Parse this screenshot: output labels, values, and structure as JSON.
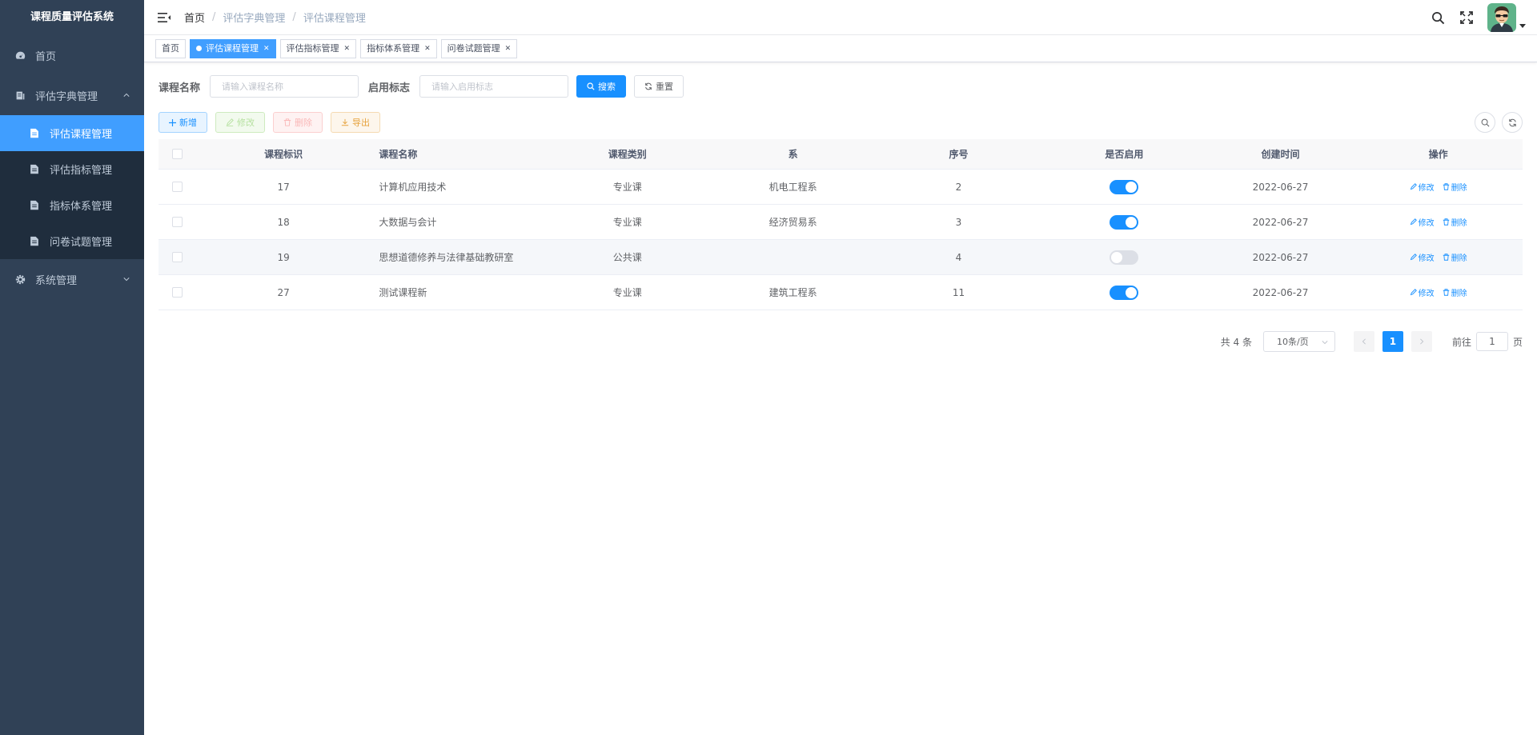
{
  "app": {
    "title": "课程质量评估系统"
  },
  "sidebar": {
    "items": [
      {
        "label": "首页",
        "icon": "dashboard-icon"
      },
      {
        "label": "评估字典管理",
        "icon": "dictionary-icon",
        "expanded": true,
        "children": [
          {
            "label": "评估课程管理",
            "active": true
          },
          {
            "label": "评估指标管理"
          },
          {
            "label": "指标体系管理"
          },
          {
            "label": "问卷试题管理"
          }
        ]
      },
      {
        "label": "系统管理",
        "icon": "gear-icon",
        "expanded": false
      }
    ]
  },
  "breadcrumb": [
    "首页",
    "评估字典管理",
    "评估课程管理"
  ],
  "tags": [
    {
      "label": "首页",
      "closable": false,
      "active": false
    },
    {
      "label": "评估课程管理",
      "closable": true,
      "active": true
    },
    {
      "label": "评估指标管理",
      "closable": true,
      "active": false
    },
    {
      "label": "指标体系管理",
      "closable": true,
      "active": false
    },
    {
      "label": "问卷试题管理",
      "closable": true,
      "active": false
    }
  ],
  "search": {
    "course_name_label": "课程名称",
    "course_name_placeholder": "请输入课程名称",
    "enabled_label": "启用标志",
    "enabled_placeholder": "请输入启用标志",
    "search_btn": "搜索",
    "reset_btn": "重置"
  },
  "toolbar": {
    "add": "新增",
    "edit": "修改",
    "delete": "删除",
    "export": "导出"
  },
  "table": {
    "headers": [
      "课程标识",
      "课程名称",
      "课程类别",
      "系",
      "序号",
      "是否启用",
      "创建时间",
      "操作"
    ],
    "rows": [
      {
        "id": "17",
        "name": "计算机应用技术",
        "category": "专业课",
        "dept": "机电工程系",
        "seq": "2",
        "enabled": true,
        "created": "2022-06-27"
      },
      {
        "id": "18",
        "name": "大数据与会计",
        "category": "专业课",
        "dept": "经济贸易系",
        "seq": "3",
        "enabled": true,
        "created": "2022-06-27"
      },
      {
        "id": "19",
        "name": "思想道德修养与法律基础教研室",
        "category": "公共课",
        "dept": "",
        "seq": "4",
        "enabled": false,
        "created": "2022-06-27"
      },
      {
        "id": "27",
        "name": "测试课程新",
        "category": "专业课",
        "dept": "建筑工程系",
        "seq": "11",
        "enabled": true,
        "created": "2022-06-27"
      }
    ],
    "op_edit": "修改",
    "op_delete": "删除"
  },
  "pagination": {
    "total": "共 4 条",
    "page_size": "10条/页",
    "current_page": "1",
    "goto_label": "前往",
    "goto_value": "1",
    "page_suffix": "页"
  },
  "colors": {
    "sidebar_bg": "#304156",
    "submenu_bg": "#1f2d3d",
    "primary": "#1890ff",
    "active_menu": "#409eff"
  }
}
